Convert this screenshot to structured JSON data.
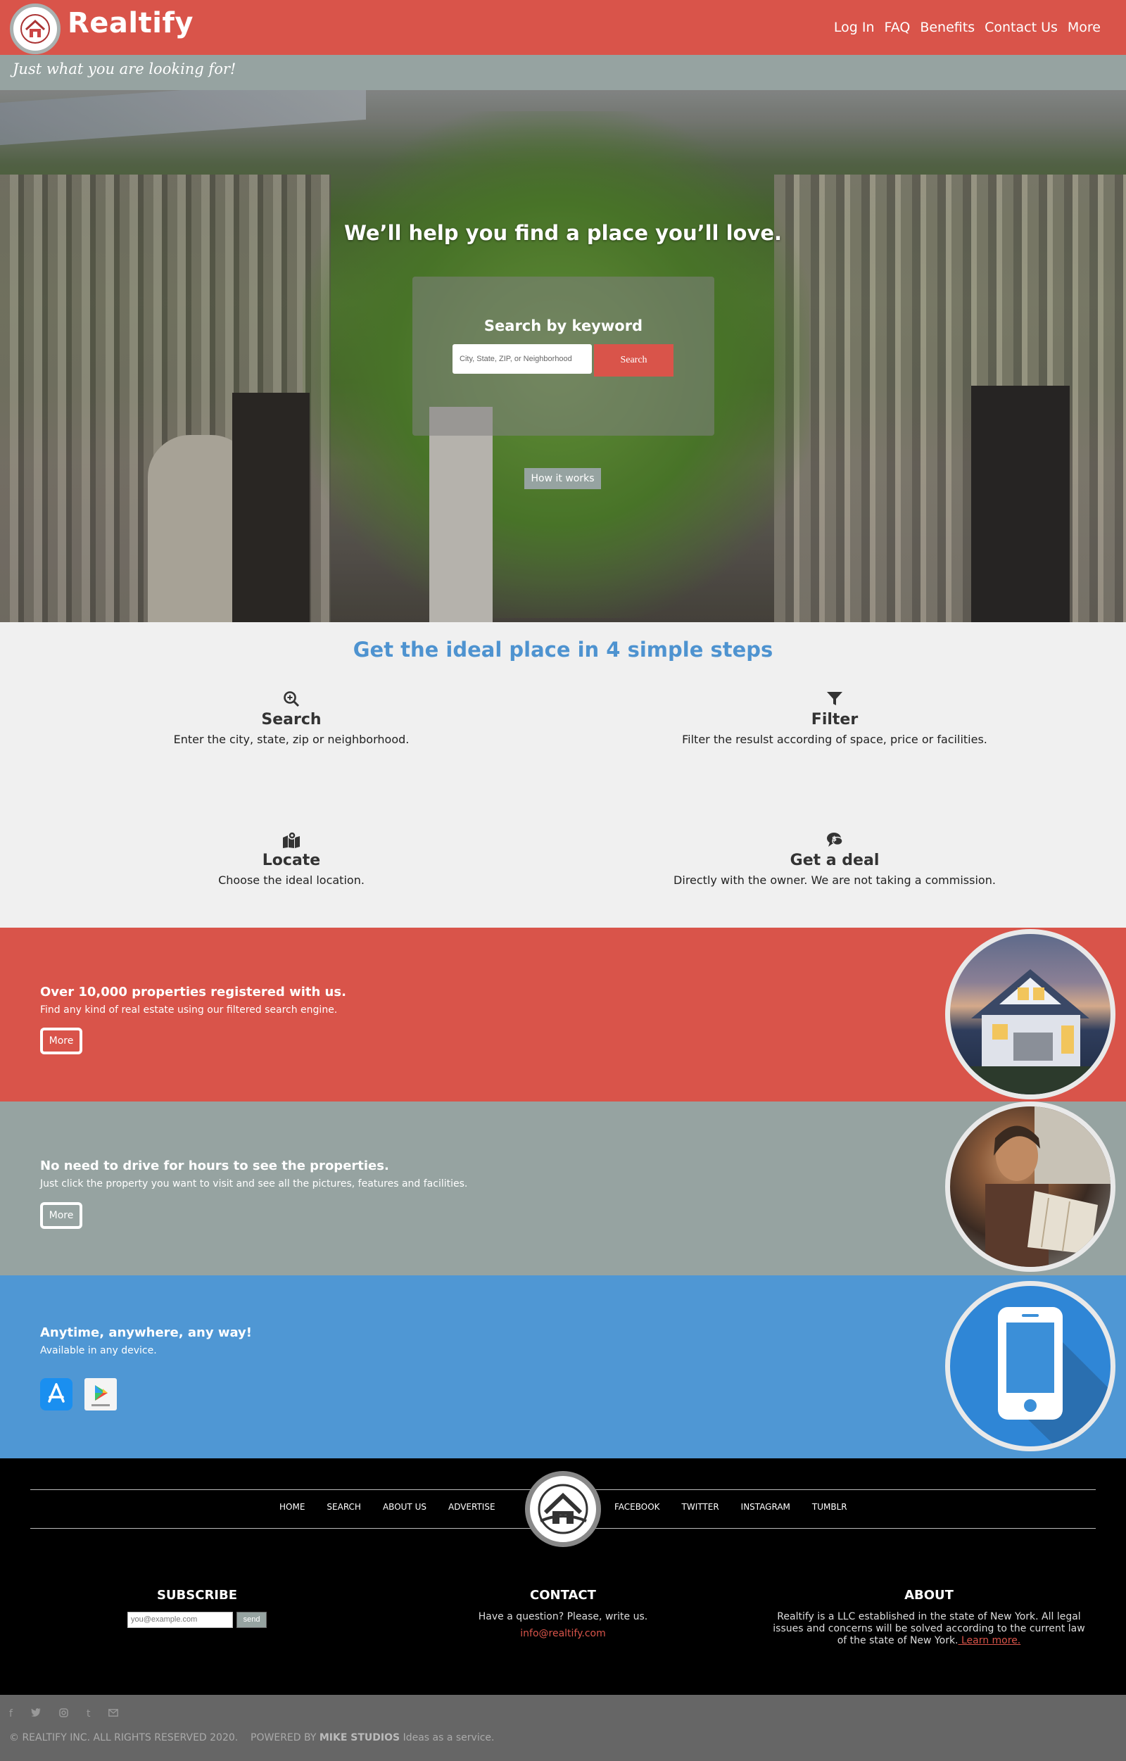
{
  "header": {
    "brand": "Realtify",
    "tagline": "Just what you are looking for!",
    "nav": [
      "Log In",
      "FAQ",
      "Benefits",
      "Contact Us",
      "More"
    ],
    "accent_color": "#d9544a"
  },
  "hero": {
    "title": "We’ll help you find a place you’ll love.",
    "search_title": "Search by keyword",
    "search_placeholder": "City, State, ZIP, or Neighborhood",
    "search_button": "Search",
    "how_button": "How it works"
  },
  "steps": {
    "title": "Get the ideal place in 4 simple steps",
    "items": [
      {
        "icon": "search-plus-icon",
        "title": "Search",
        "text": "Enter the city, state, zip or neighborhood."
      },
      {
        "icon": "filter-icon",
        "title": "Filter",
        "text": "Filter the resulst according of space, price or facilities."
      },
      {
        "icon": "map-marker-icon",
        "title": "Locate",
        "text": "Choose the ideal location."
      },
      {
        "icon": "chat-dollar-icon",
        "title": "Get a deal",
        "text": "Directly with the owner. We are not taking a commission."
      }
    ]
  },
  "features": [
    {
      "title": "Over 10,000 properties registered with us.",
      "text": "Find any kind of real estate using our filtered search engine.",
      "button": "More",
      "image": "house-photo"
    },
    {
      "title": "No need to drive for hours to see the properties.",
      "text": "Just click the property you want to visit and see all the pictures, features and facilities.",
      "button": "More",
      "image": "driver-map-photo"
    },
    {
      "title": "Anytime, anywhere, any way!",
      "text": "Available in any device.",
      "image": "smartphone-icon"
    }
  ],
  "footer": {
    "nav_left": [
      "HOME",
      "SEARCH",
      "ABOUT US",
      "ADVERTISE"
    ],
    "nav_right": [
      "FACEBOOK",
      "TWITTER",
      "INSTAGRAM",
      "TUMBLR"
    ],
    "subscribe": {
      "title": "SUBSCRIBE",
      "placeholder": "you@example.com",
      "button": "send"
    },
    "contact": {
      "title": "CONTACT",
      "text": "Have a question? Please, write us.",
      "email": "info@realtify.com"
    },
    "about": {
      "title": "ABOUT",
      "text": "Realtify is a LLC established in the state of New York. All legal issues and concerns will be solved according to the current law of the state of New York.",
      "link": " Learn more."
    },
    "social_icons": [
      "facebook-icon",
      "twitter-icon",
      "instagram-icon",
      "tumblr-icon",
      "mail-icon"
    ],
    "copyright": "© REALTIFY INC. ALL RIGHTS RESERVED 2020.",
    "powered_prefix": "POWERED BY",
    "powered_name": "MIKE STUDIOS",
    "powered_suffix": "Ideas as a service."
  }
}
